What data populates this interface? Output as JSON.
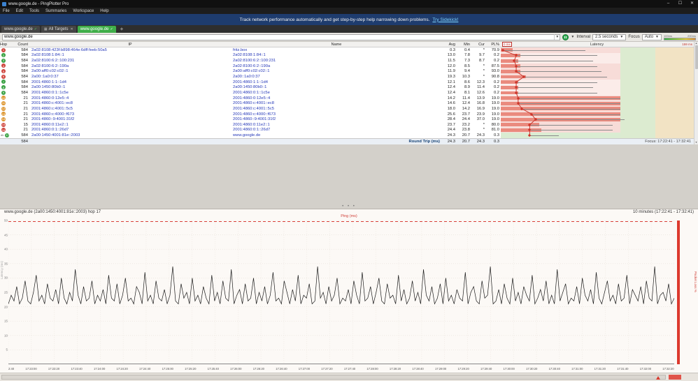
{
  "window": {
    "title": "www.google.de - PingPlotter Pro",
    "minimize": "–",
    "maximize": "☐",
    "close": "✕"
  },
  "menu": {
    "items": [
      "File",
      "Edit",
      "Tools",
      "Summaries",
      "Workspace",
      "Help"
    ]
  },
  "notification": {
    "text": "Track network performance automatically and get step-by-step help narrowing down problems.",
    "link": "Try Sidekick!"
  },
  "tabs": [
    {
      "label": "www.google.de",
      "check": "✓"
    },
    {
      "label": "All Targets",
      "icon": "▦",
      "close": "✕"
    },
    {
      "label": "www.google.de",
      "check": "✓",
      "active": true
    }
  ],
  "tab_add": "+",
  "toolbar": {
    "target_value": "www.google.de",
    "interval_label": "Interval",
    "interval_value": "2.5 seconds",
    "focus_label": "Focus",
    "focus_value": "Auto",
    "legend_labels": [
      "100ms",
      "200ms"
    ]
  },
  "table": {
    "columns": [
      "Hop",
      "Count",
      "IP",
      "Name",
      "Avg",
      "Min",
      "Cur",
      "PL%"
    ],
    "latency_header": {
      "label": "Latency",
      "min": "0 ms",
      "max": "159 ms"
    },
    "rows": [
      {
        "hop": "1",
        "count": "584",
        "ip": "2a02:8108:423f:b898:464e:6dff:feeb:50a5",
        "name": "fritz.box",
        "avg": "0.3",
        "min": "0.4",
        "cur": "*",
        "pl": "70.9",
        "status": "bad",
        "bar": 6,
        "dot": 1,
        "range": 44
      },
      {
        "hop": "2",
        "count": "584",
        "ip": "2a02:8108:1:84::1",
        "name": "2a02:8108:1:84::1",
        "avg": "13.0",
        "min": "7.8",
        "cur": "9.7",
        "pl": "0.2",
        "status": "good",
        "bar": 10,
        "dot": 8,
        "range": 50,
        "clean": true
      },
      {
        "hop": "3",
        "count": "584",
        "ip": "2a02:8100:6:2::100:231",
        "name": "2a02:8100:6:2::100:231",
        "avg": "11.5",
        "min": "7.3",
        "cur": "8.7",
        "pl": "0.2",
        "status": "good",
        "bar": 9,
        "dot": 7,
        "range": 48,
        "clean": true
      },
      {
        "hop": "4",
        "count": "584",
        "ip": "2a02:8100:6:2::190a",
        "name": "2a02:8100:6:2::190a",
        "avg": "12.0",
        "min": "8.5",
        "cur": "*",
        "pl": "87.5",
        "status": "bad",
        "bar": 10,
        "dot": 8,
        "range": 50
      },
      {
        "hop": "5",
        "count": "584",
        "ip": "2a00:aff0:c02:c02::1",
        "name": "2a00:aff0:c02:c02::1",
        "avg": "11.9",
        "min": "9.4",
        "cur": "*",
        "pl": "93.0",
        "status": "bad",
        "bar": 10,
        "dot": 8,
        "range": 52
      },
      {
        "hop": "6",
        "count": "584",
        "ip": "2a00::1a0:0:37",
        "name": "2a00::1a0:0:37",
        "avg": "19.3",
        "min": "10.3",
        "cur": "*",
        "pl": "90.8",
        "status": "bad",
        "bar": 13,
        "dot": 12,
        "range": 55
      },
      {
        "hop": "7",
        "count": "584",
        "ip": "2001:4860:1:1::1d4",
        "name": "2001:4860:1:1::1d4",
        "avg": "12.1",
        "min": "8.6",
        "cur": "12.3",
        "pl": "0.2",
        "status": "good",
        "bar": 9,
        "dot": 8,
        "range": 50,
        "clean": true
      },
      {
        "hop": "8",
        "count": "584",
        "ip": "2a00:1450:80b0::1",
        "name": "2a00:1450:80b0::1",
        "avg": "12.4",
        "min": "8.9",
        "cur": "11.4",
        "pl": "0.2",
        "status": "good",
        "bar": 9,
        "dot": 8,
        "range": 48,
        "clean": true
      },
      {
        "hop": "9",
        "count": "584",
        "ip": "2001:4860:0:1::1c5e",
        "name": "2001:4860:0:1::1c5e",
        "avg": "12.4",
        "min": "8.1",
        "cur": "12.6",
        "pl": "0.2",
        "status": "good",
        "bar": 9,
        "dot": 8,
        "range": 50,
        "clean": true
      },
      {
        "hop": "10",
        "count": "21",
        "ip": "2001:4860:0:12e5::4",
        "name": "2001:4860:0:12e5::4",
        "avg": "14.2",
        "min": "11.4",
        "cur": "13.9",
        "pl": "19.0",
        "status": "warn",
        "bar": 62,
        "dot": 9,
        "range": 62
      },
      {
        "hop": "11",
        "count": "21",
        "ip": "2001:4860:c:4001::ec8",
        "name": "2001:4860:c:4001::ec8",
        "avg": "14.6",
        "min": "12.4",
        "cur": "16.8",
        "pl": "19.0",
        "status": "warn",
        "bar": 62,
        "dot": 9,
        "range": 62
      },
      {
        "hop": "12",
        "count": "21",
        "ip": "2001:4860:c:4001::5c5",
        "name": "2001:4860:c:4001::5c5",
        "avg": "18.0",
        "min": "14.2",
        "cur": "16.9",
        "pl": "19.0",
        "status": "warn",
        "bar": 62,
        "dot": 11,
        "range": 62
      },
      {
        "hop": "13",
        "count": "21",
        "ip": "2001:4860:c:4000::f673",
        "name": "2001:4860:c:4000::f673",
        "avg": "25.6",
        "min": "23.7",
        "cur": "23.9",
        "pl": "19.0",
        "status": "warn",
        "bar": 62,
        "dot": 16,
        "range": 62
      },
      {
        "hop": "14",
        "count": "21",
        "ip": "2001:4860::9:4001:31f2",
        "name": "2001:4860::9:4001:31f2",
        "avg": "28.4",
        "min": "24.4",
        "cur": "37.0",
        "pl": "19.0",
        "status": "warn",
        "bar": 62,
        "dot": 18,
        "range": 64
      },
      {
        "hop": "15",
        "count": "15",
        "ip": "2001:4860:0:11e2::1",
        "name": "2001:4860:0:11e2::1",
        "avg": "23.7",
        "min": "23.2",
        "cur": "*",
        "pl": "80.0",
        "status": "bad",
        "bar": 20,
        "dot": 15,
        "range": 58
      },
      {
        "hop": "16",
        "count": "21",
        "ip": "2001:4860:0:1::26d7",
        "name": "2001:4860:0:1::26d7",
        "avg": "24.4",
        "min": "23.8",
        "cur": "*",
        "pl": "81.0",
        "status": "bad",
        "bar": 21,
        "dot": 15,
        "range": 58
      },
      {
        "hop": "17",
        "count": "584",
        "ip": "2a00:1450:4001:81e::2003",
        "name": "www.google.de",
        "avg": "24.3",
        "min": "20.7",
        "cur": "24.3",
        "pl": "0.3",
        "status": "good",
        "bar": 0,
        "dot": 15,
        "range": 30,
        "dest": true
      }
    ],
    "footer": {
      "count": "584",
      "label": "Round Trip (ms)",
      "avg": "24.3",
      "min": "20.7",
      "cur": "24.3",
      "pl": "0.3"
    },
    "focus_text": "Focus: 17:22:41 - 17:32:41"
  },
  "colors": {
    "accent_green": "#3fae49",
    "loss_red": "#dc3a2e",
    "warn_orange": "#dd9630",
    "link_blue": "#2437b8"
  },
  "chart_data": {
    "type": "line",
    "title": "www.google.de (2a00:1450:4001:81e::2003) hop 17",
    "period_label": "10 minutes (17:22:41 - 17:32:41)",
    "series_label": "Ping (ms)",
    "ylabel": "Latency (ms)",
    "y2label": "Packet Loss %",
    "ylim": [
      0,
      50
    ],
    "yticks": [
      50,
      45,
      40,
      35,
      30,
      25,
      20,
      15,
      10,
      5
    ],
    "grid": true,
    "xticks": [
      "2:40",
      "17:23:00",
      "17:23:20",
      "17:23:40",
      "17:24:00",
      "17:24:20",
      "17:24:40",
      "17:25:00",
      "17:25:20",
      "17:25:40",
      "17:26:00",
      "17:26:20",
      "17:26:40",
      "17:27:00",
      "17:27:20",
      "17:27:40",
      "17:28:00",
      "17:28:20",
      "17:28:40",
      "17:29:00",
      "17:29:20",
      "17:29:40",
      "17:30:00",
      "17:30:20",
      "17:30:40",
      "17:31:00",
      "17:31:20",
      "17:31:40",
      "17:32:00",
      "17:32:20"
    ],
    "values": [
      21,
      24,
      22,
      27,
      21,
      23,
      29,
      22,
      21,
      25,
      31,
      22,
      24,
      21,
      28,
      23,
      22,
      26,
      21,
      30,
      23,
      21,
      25,
      22,
      33,
      24,
      21,
      27,
      22,
      23,
      29,
      21,
      24,
      22,
      26,
      21,
      31,
      23,
      22,
      28,
      21,
      24,
      30,
      22,
      23,
      21,
      27,
      25,
      21,
      32,
      22,
      24,
      21,
      29,
      23,
      22,
      26,
      21,
      24,
      34,
      22,
      21,
      28,
      23,
      25,
      21,
      30,
      22,
      24,
      21,
      27,
      23,
      21,
      31,
      22,
      25,
      21,
      29,
      23,
      22,
      33,
      21,
      24,
      26,
      21,
      28,
      22,
      23,
      30,
      21,
      25,
      22,
      27,
      21,
      24,
      32,
      22,
      23,
      21,
      29,
      25,
      21,
      26,
      22,
      31,
      21,
      24,
      23,
      28,
      21,
      22,
      34,
      23,
      25,
      21,
      27,
      22,
      24,
      30,
      21,
      23,
      22,
      26,
      21,
      29,
      24,
      21,
      32,
      22,
      23,
      27,
      21,
      25,
      30,
      22,
      21,
      28,
      23,
      24,
      21,
      31,
      22,
      26,
      21,
      23,
      29,
      22,
      25,
      21,
      33,
      24,
      22,
      27,
      21,
      23,
      28,
      21,
      30,
      22,
      24,
      21,
      26,
      23,
      22,
      32,
      21,
      25,
      27,
      22,
      21,
      29,
      23,
      24,
      34,
      21,
      22,
      26,
      21,
      28,
      23,
      21,
      30,
      22,
      25,
      21,
      27,
      24,
      22,
      31,
      21,
      23,
      26,
      22,
      29,
      21,
      24,
      21,
      33,
      22,
      25,
      28,
      21,
      23,
      22,
      27,
      21,
      30,
      24,
      22,
      26,
      21,
      32,
      23,
      21,
      25,
      29,
      22,
      24,
      21,
      28,
      22,
      23,
      31,
      21,
      26,
      24,
      22,
      27,
      21,
      29,
      23,
      22,
      34,
      21,
      24,
      25,
      22,
      28,
      21,
      23
    ],
    "loss_event_at_end": true
  }
}
